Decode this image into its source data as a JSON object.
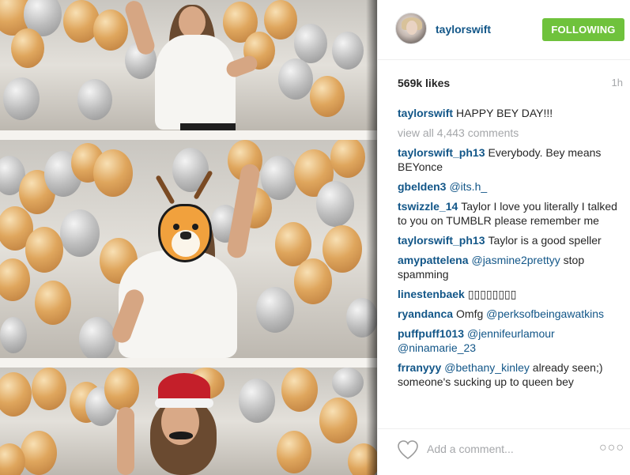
{
  "post": {
    "image_alt": "photo strip"
  },
  "header": {
    "username": "taylorswift",
    "follow_label": "FOLLOWING",
    "follow_color": "#6fc23c"
  },
  "meta": {
    "likes": "569k likes",
    "time_ago": "1h"
  },
  "caption": {
    "author": "taylorswift",
    "text": "HAPPY BEY DAY!!!"
  },
  "view_all_comments": "view all 4,443 comments",
  "comments": [
    {
      "author": "taylorswift_ph13",
      "mention": "",
      "text": "Everybody. Bey means BEYonce"
    },
    {
      "author": "gbelden3",
      "mention": "@its.h_",
      "text": ""
    },
    {
      "author": "tswizzle_14",
      "mention": "",
      "text": "Taylor I love you literally I talked to you on TUMBLR please remember me"
    },
    {
      "author": "taylorswift_ph13",
      "mention": "",
      "text": "Taylor is a good speller"
    },
    {
      "author": "amypattelena",
      "mention": "@jasmine2prettyy",
      "text": "stop spamming"
    },
    {
      "author": "linestenbaek",
      "mention": "",
      "text": "▯▯▯▯▯▯▯▯"
    },
    {
      "author": "ryandanca",
      "mention": "",
      "text": "Omfg",
      "mention_after": "@perksofbeingawatkins"
    },
    {
      "author": "puffpuff1013",
      "mention": "@jennifeurlamour @ninamarie_23",
      "text": ""
    },
    {
      "author": "frranyyy",
      "mention": "@bethany_kinley",
      "text": "already seen;) someone's sucking up to queen bey"
    }
  ],
  "footer": {
    "add_comment_placeholder": "Add a comment...",
    "more_label": "○○○",
    "heart_icon": "heart-outline-icon"
  },
  "colors": {
    "link_blue": "#125688",
    "muted_gray": "#a5a7aa"
  }
}
